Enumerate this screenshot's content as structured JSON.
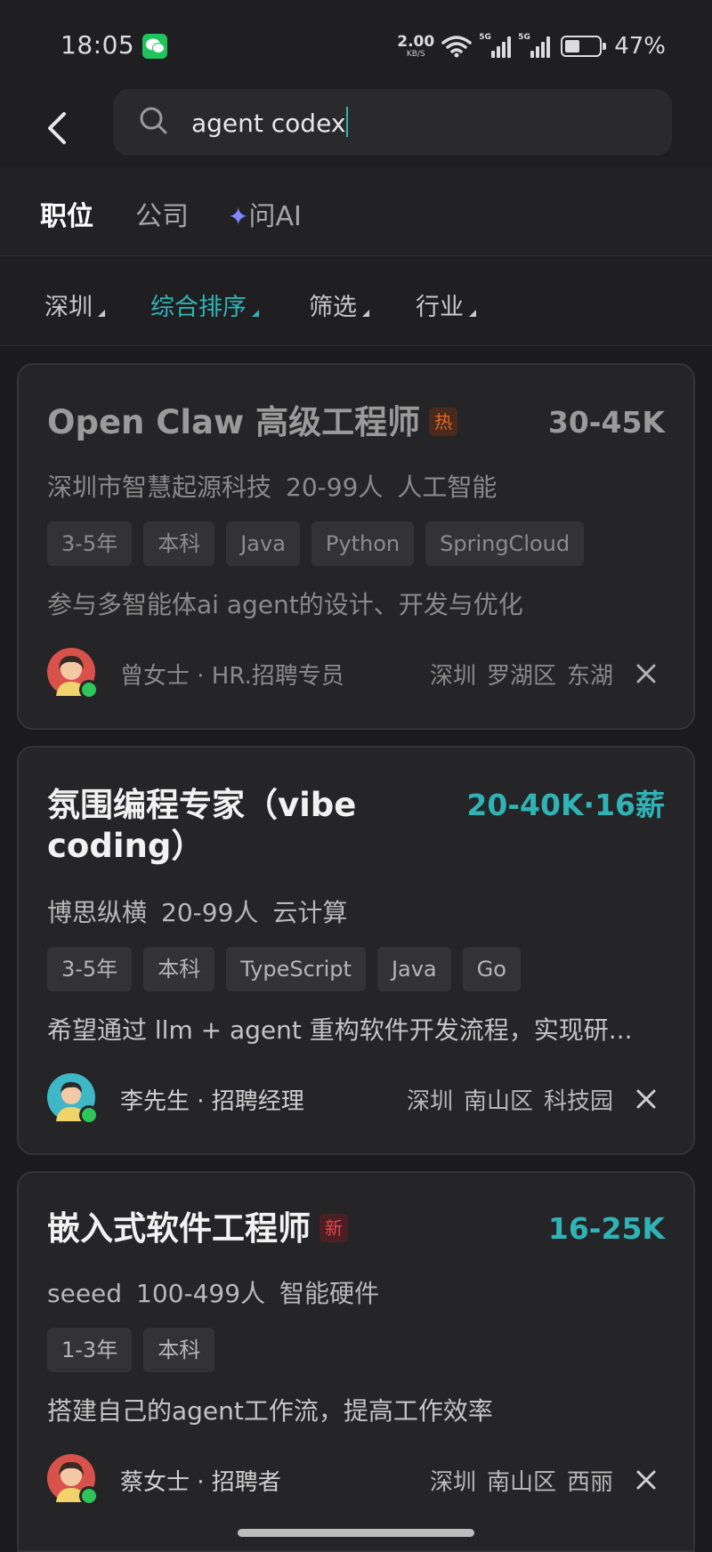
{
  "status_bar": {
    "time": "18:05",
    "net_speed_value": "2.00",
    "net_speed_unit": "KB/S",
    "signal_1_label": "5G",
    "signal_2_label": "5G",
    "battery_percent": "47%"
  },
  "search": {
    "query": "agent codex"
  },
  "tabs": [
    {
      "label": "职位",
      "active": true
    },
    {
      "label": "公司",
      "active": false
    },
    {
      "label": "问AI",
      "active": false
    }
  ],
  "filters": [
    {
      "label": "深圳",
      "active": false
    },
    {
      "label": "综合排序",
      "active": true
    },
    {
      "label": "筛选",
      "active": false
    },
    {
      "label": "行业",
      "active": false
    }
  ],
  "jobs": [
    {
      "title": "Open Claw 高级工程师",
      "badge": "热",
      "salary": "30-45K",
      "company": "深圳市智慧起源科技",
      "size": "20-99人",
      "industry": "人工智能",
      "tags": [
        "3-5年",
        "本科",
        "Java",
        "Python",
        "SpringCloud"
      ],
      "description": "参与多智能体ai agent的设计、开发与优化",
      "recruiter": "曾女士 · HR.招聘专员",
      "location": [
        "深圳",
        "罗湖区",
        "东湖"
      ]
    },
    {
      "title_line1": "氛围编程专家（vibe",
      "title_line2": "coding）",
      "salary": "20-40K·16薪",
      "company": "博思纵横",
      "size": "20-99人",
      "industry": "云计算",
      "tags": [
        "3-5年",
        "本科",
        "TypeScript",
        "Java",
        "Go"
      ],
      "description": "希望通过 llm + agent 重构软件开发流程，实现研...",
      "recruiter": "李先生 · 招聘经理",
      "location": [
        "深圳",
        "南山区",
        "科技园"
      ]
    },
    {
      "title": "嵌入式软件工程师",
      "badge": "新",
      "salary": "16-25K",
      "company": "seeed",
      "size": "100-499人",
      "industry": "智能硬件",
      "tags": [
        "1-3年",
        "本科"
      ],
      "description": "搭建自己的agent工作流，提高工作效率",
      "recruiter": "蔡女士 · 招聘者",
      "location": [
        "深圳",
        "南山区",
        "西丽"
      ]
    }
  ],
  "colors": {
    "accent": "#2fb3b6",
    "hot_badge": "#e06a2b",
    "new_badge": "#e0484e",
    "ai_star": "#7f86ff",
    "online": "#2fc55a"
  }
}
